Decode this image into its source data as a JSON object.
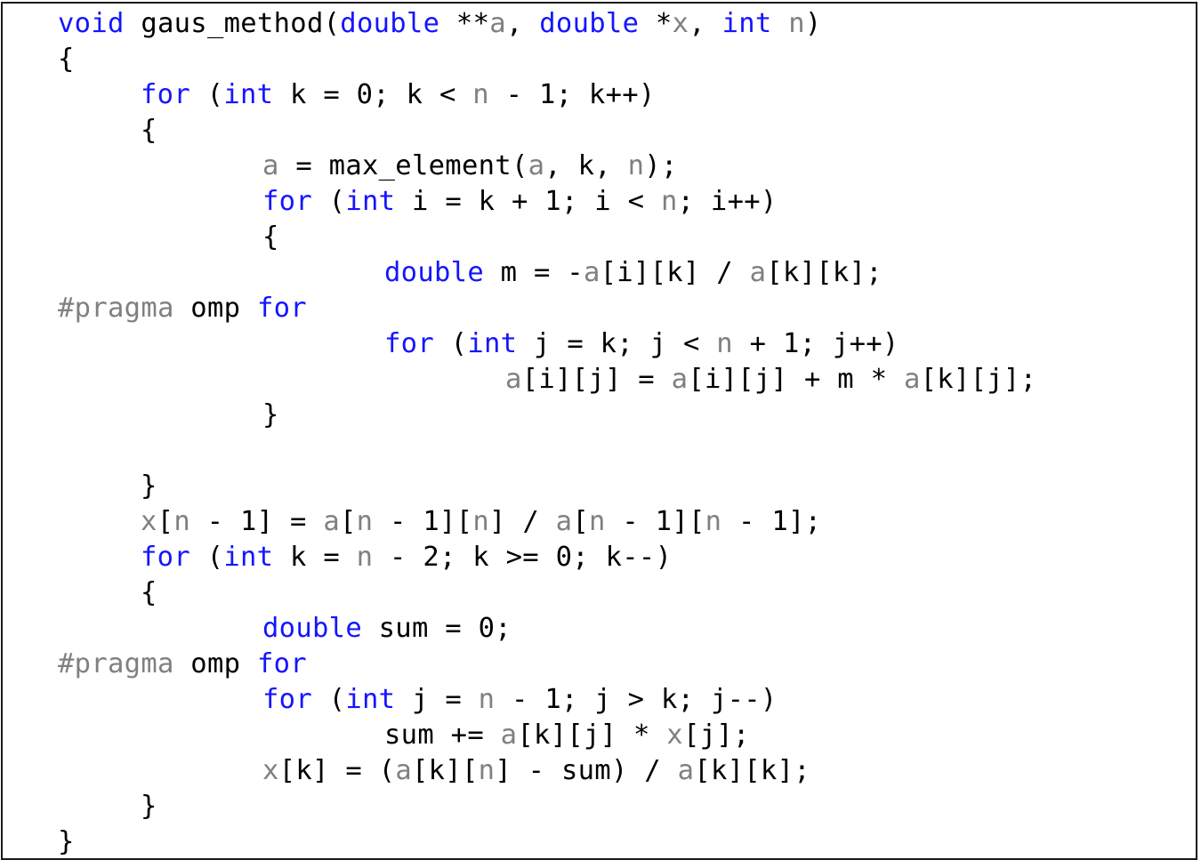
{
  "document": {
    "language": "C",
    "colors": {
      "keyword": "#1515ff",
      "parameter": "#808080",
      "preprocessor": "#808080",
      "text": "#000000",
      "border": "#1a1a1a",
      "background": "#ffffff"
    },
    "lines": [
      {
        "indent": 0,
        "tokens": [
          {
            "t": "kw",
            "v": "void"
          },
          {
            "t": "tx",
            "v": " gaus_method("
          },
          {
            "t": "kw",
            "v": "double"
          },
          {
            "t": "tx",
            "v": " **"
          },
          {
            "t": "id",
            "v": "a"
          },
          {
            "t": "tx",
            "v": ", "
          },
          {
            "t": "kw",
            "v": "double"
          },
          {
            "t": "tx",
            "v": " *"
          },
          {
            "t": "id",
            "v": "x"
          },
          {
            "t": "tx",
            "v": ", "
          },
          {
            "t": "kw",
            "v": "int"
          },
          {
            "t": "tx",
            "v": " "
          },
          {
            "t": "id",
            "v": "n"
          },
          {
            "t": "tx",
            "v": ")"
          }
        ]
      },
      {
        "indent": 0,
        "tokens": [
          {
            "t": "tx",
            "v": "{"
          }
        ]
      },
      {
        "indent": 1,
        "tokens": [
          {
            "t": "kw",
            "v": "for"
          },
          {
            "t": "tx",
            "v": " ("
          },
          {
            "t": "kw",
            "v": "int"
          },
          {
            "t": "tx",
            "v": " k = 0; k < "
          },
          {
            "t": "id",
            "v": "n"
          },
          {
            "t": "tx",
            "v": " - 1; k++)"
          }
        ]
      },
      {
        "indent": 1,
        "tokens": [
          {
            "t": "tx",
            "v": "{"
          }
        ]
      },
      {
        "indent": 2,
        "tokens": [
          {
            "t": "id",
            "v": "a"
          },
          {
            "t": "tx",
            "v": " = max_element("
          },
          {
            "t": "id",
            "v": "a"
          },
          {
            "t": "tx",
            "v": ", k, "
          },
          {
            "t": "id",
            "v": "n"
          },
          {
            "t": "tx",
            "v": ");"
          }
        ]
      },
      {
        "indent": 2,
        "tokens": [
          {
            "t": "kw",
            "v": "for"
          },
          {
            "t": "tx",
            "v": " ("
          },
          {
            "t": "kw",
            "v": "int"
          },
          {
            "t": "tx",
            "v": " i = k + 1; i < "
          },
          {
            "t": "id",
            "v": "n"
          },
          {
            "t": "tx",
            "v": "; i++)"
          }
        ]
      },
      {
        "indent": 2,
        "tokens": [
          {
            "t": "tx",
            "v": "{"
          }
        ]
      },
      {
        "indent": 3,
        "tokens": [
          {
            "t": "kw",
            "v": "double"
          },
          {
            "t": "tx",
            "v": " m = -"
          },
          {
            "t": "id",
            "v": "a"
          },
          {
            "t": "tx",
            "v": "[i][k] / "
          },
          {
            "t": "id",
            "v": "a"
          },
          {
            "t": "tx",
            "v": "[k][k];"
          }
        ]
      },
      {
        "indent": 0,
        "tokens": [
          {
            "t": "pp",
            "v": "#pragma"
          },
          {
            "t": "tx",
            "v": " omp "
          },
          {
            "t": "kw",
            "v": "for"
          }
        ]
      },
      {
        "indent": 3,
        "tokens": [
          {
            "t": "kw",
            "v": "for"
          },
          {
            "t": "tx",
            "v": " ("
          },
          {
            "t": "kw",
            "v": "int"
          },
          {
            "t": "tx",
            "v": " j = k; j < "
          },
          {
            "t": "id",
            "v": "n"
          },
          {
            "t": "tx",
            "v": " + 1; j++)"
          }
        ]
      },
      {
        "indent": 4,
        "tokens": [
          {
            "t": "id",
            "v": "a"
          },
          {
            "t": "tx",
            "v": "[i][j] = "
          },
          {
            "t": "id",
            "v": "a"
          },
          {
            "t": "tx",
            "v": "[i][j] + m * "
          },
          {
            "t": "id",
            "v": "a"
          },
          {
            "t": "tx",
            "v": "[k][j];"
          }
        ]
      },
      {
        "indent": 2,
        "tokens": [
          {
            "t": "tx",
            "v": "}"
          }
        ]
      },
      {
        "indent": 0,
        "tokens": []
      },
      {
        "indent": 1,
        "tokens": [
          {
            "t": "tx",
            "v": "}"
          }
        ]
      },
      {
        "indent": 1,
        "tokens": [
          {
            "t": "id",
            "v": "x"
          },
          {
            "t": "tx",
            "v": "["
          },
          {
            "t": "id",
            "v": "n"
          },
          {
            "t": "tx",
            "v": " - 1] = "
          },
          {
            "t": "id",
            "v": "a"
          },
          {
            "t": "tx",
            "v": "["
          },
          {
            "t": "id",
            "v": "n"
          },
          {
            "t": "tx",
            "v": " - 1]["
          },
          {
            "t": "id",
            "v": "n"
          },
          {
            "t": "tx",
            "v": "] / "
          },
          {
            "t": "id",
            "v": "a"
          },
          {
            "t": "tx",
            "v": "["
          },
          {
            "t": "id",
            "v": "n"
          },
          {
            "t": "tx",
            "v": " - 1]["
          },
          {
            "t": "id",
            "v": "n"
          },
          {
            "t": "tx",
            "v": " - 1];"
          }
        ]
      },
      {
        "indent": 1,
        "tokens": [
          {
            "t": "kw",
            "v": "for"
          },
          {
            "t": "tx",
            "v": " ("
          },
          {
            "t": "kw",
            "v": "int"
          },
          {
            "t": "tx",
            "v": " k = "
          },
          {
            "t": "id",
            "v": "n"
          },
          {
            "t": "tx",
            "v": " - 2; k >= 0; k--)"
          }
        ]
      },
      {
        "indent": 1,
        "tokens": [
          {
            "t": "tx",
            "v": "{"
          }
        ]
      },
      {
        "indent": 2,
        "tokens": [
          {
            "t": "kw",
            "v": "double"
          },
          {
            "t": "tx",
            "v": " sum = 0;"
          }
        ]
      },
      {
        "indent": 0,
        "tokens": [
          {
            "t": "pp",
            "v": "#pragma"
          },
          {
            "t": "tx",
            "v": " omp "
          },
          {
            "t": "kw",
            "v": "for"
          }
        ]
      },
      {
        "indent": 2,
        "tokens": [
          {
            "t": "kw",
            "v": "for"
          },
          {
            "t": "tx",
            "v": " ("
          },
          {
            "t": "kw",
            "v": "int"
          },
          {
            "t": "tx",
            "v": " j = "
          },
          {
            "t": "id",
            "v": "n"
          },
          {
            "t": "tx",
            "v": " - 1; j > k; j--)"
          }
        ]
      },
      {
        "indent": 3,
        "tokens": [
          {
            "t": "tx",
            "v": "sum += "
          },
          {
            "t": "id",
            "v": "a"
          },
          {
            "t": "tx",
            "v": "[k][j] * "
          },
          {
            "t": "id",
            "v": "x"
          },
          {
            "t": "tx",
            "v": "[j];"
          }
        ]
      },
      {
        "indent": 2,
        "tokens": [
          {
            "t": "id",
            "v": "x"
          },
          {
            "t": "tx",
            "v": "[k] = ("
          },
          {
            "t": "id",
            "v": "a"
          },
          {
            "t": "tx",
            "v": "[k]["
          },
          {
            "t": "id",
            "v": "n"
          },
          {
            "t": "tx",
            "v": "] - sum) / "
          },
          {
            "t": "id",
            "v": "a"
          },
          {
            "t": "tx",
            "v": "[k][k];"
          }
        ]
      },
      {
        "indent": 1,
        "tokens": [
          {
            "t": "tx",
            "v": "}"
          }
        ]
      },
      {
        "indent": 0,
        "tokens": [
          {
            "t": "tx",
            "v": "}"
          }
        ]
      }
    ]
  }
}
